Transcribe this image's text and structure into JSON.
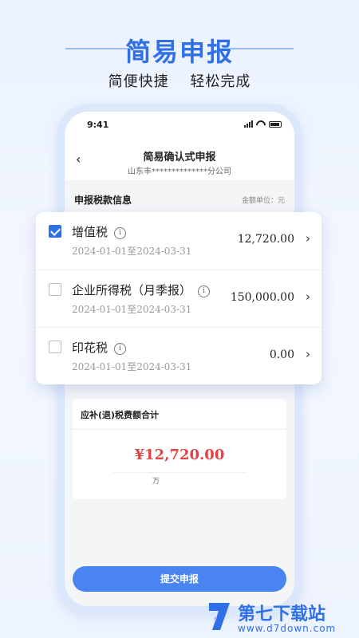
{
  "promo": {
    "title": "简易申报",
    "subtitle_left": "简便快捷",
    "subtitle_right": "轻松完成"
  },
  "status_bar": {
    "time": "9:41"
  },
  "nav": {
    "title": "简易确认式申报",
    "company": "山东丰**************分公司"
  },
  "section": {
    "label": "申报税款信息",
    "unit": "金额单位：元"
  },
  "taxes": [
    {
      "name": "增值税",
      "period": "2024-01-01至2024-03-31",
      "amount": "12,720.00",
      "checked": true
    },
    {
      "name": "企业所得税（月季报）",
      "period": "2024-01-01至2024-03-31",
      "amount": "150,000.00",
      "checked": false
    },
    {
      "name": "印花税",
      "period": "2024-01-01至2024-03-31",
      "amount": "0.00",
      "checked": false
    }
  ],
  "summary": {
    "title": "应补(退)税费额合计",
    "amount": "¥12,720.00",
    "unit_hint": "万"
  },
  "submit_label": "提交申报",
  "watermark": {
    "name": "第七下载站",
    "url": "www.d7down.com"
  },
  "colors": {
    "accent": "#2f6fe8",
    "button": "#4a84f0",
    "amount_red": "#e04444"
  }
}
